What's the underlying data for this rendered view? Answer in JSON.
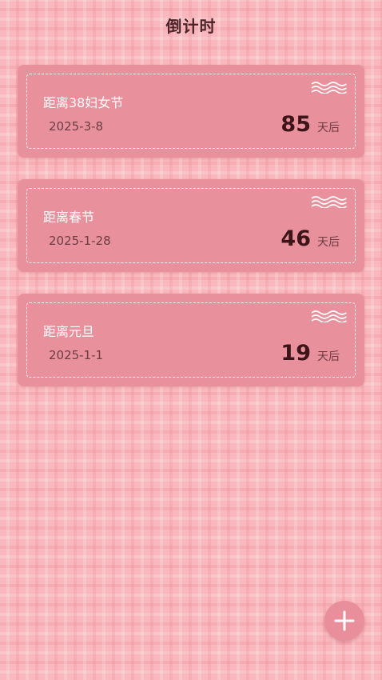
{
  "header": {
    "title": "倒计时"
  },
  "countdowns": [
    {
      "name": "距离38妇女节",
      "date": "2025-3-8",
      "days": "85",
      "unit": "天后"
    },
    {
      "name": "距离春节",
      "date": "2025-1-28",
      "days": "46",
      "unit": "天后"
    },
    {
      "name": "距离元旦",
      "date": "2025-1-1",
      "days": "19",
      "unit": "天后"
    }
  ],
  "fab": {
    "icon": "plus-icon"
  },
  "colors": {
    "background": "#f9b8bd",
    "card": "#e8919d",
    "title_text": "#4a2428",
    "count_text": "#3d1518"
  }
}
